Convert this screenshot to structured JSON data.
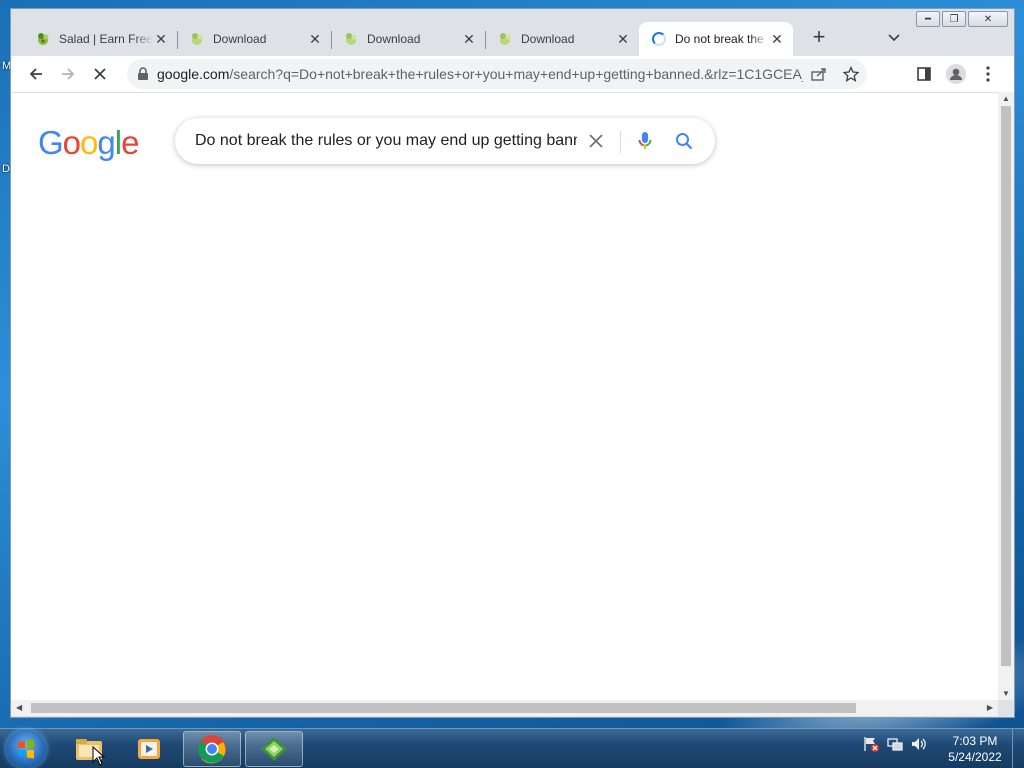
{
  "desktop": {
    "left_letter_1": "M",
    "left_letter_2": "D"
  },
  "browser": {
    "tabs": [
      {
        "title": "Salad | Earn Free",
        "favicon": "salad-icon"
      },
      {
        "title": "Download",
        "favicon": "salad-icon"
      },
      {
        "title": "Download",
        "favicon": "salad-icon"
      },
      {
        "title": "Download",
        "favicon": "salad-icon"
      },
      {
        "title": "Do not break the",
        "favicon": "loading-spinner-icon",
        "active": true
      }
    ],
    "new_tab_label": "+",
    "address": {
      "host": "google.com",
      "path": "/search?q=Do+not+break+the+rules+or+you+may+end+up+getting+banned.&rlz=1C1GCEA_..."
    }
  },
  "page": {
    "logo_text": "Google",
    "search_query": "Do not break the rules or you may end up getting banned."
  },
  "taskbar": {
    "time": "7:03 PM",
    "date": "5/24/2022"
  },
  "colors": {
    "google_blue": "#4285F4",
    "google_red": "#EA4335",
    "google_yellow": "#FBBC05",
    "google_green": "#34A853",
    "salad_green": "#7cbf3a"
  }
}
